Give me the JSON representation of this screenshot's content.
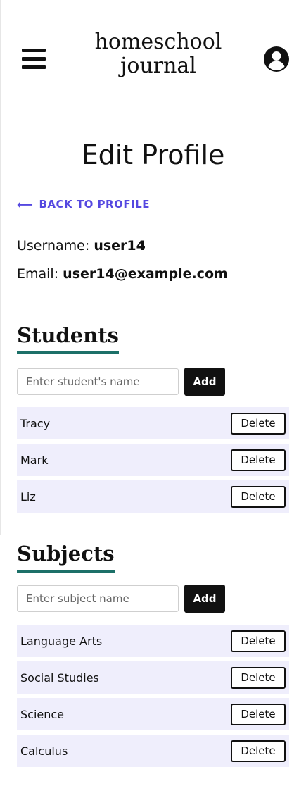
{
  "header": {
    "logo_line1": "homeschool",
    "logo_line2": "journal"
  },
  "page": {
    "title": "Edit Profile",
    "back_label": "BACK TO PROFILE",
    "back_arrow": "⟵"
  },
  "profile": {
    "username_label": "Username:",
    "username": "user14",
    "email_label": "Email:",
    "email": "user14@example.com"
  },
  "students": {
    "heading": "Students",
    "placeholder": "Enter student's name",
    "add_label": "Add",
    "items": [
      {
        "name": "Tracy",
        "delete_label": "Delete"
      },
      {
        "name": "Mark",
        "delete_label": "Delete"
      },
      {
        "name": "Liz",
        "delete_label": "Delete"
      }
    ]
  },
  "subjects": {
    "heading": "Subjects",
    "placeholder": "Enter subject name",
    "add_label": "Add",
    "items": [
      {
        "name": "Language Arts",
        "delete_label": "Delete"
      },
      {
        "name": "Social Studies",
        "delete_label": "Delete"
      },
      {
        "name": "Science",
        "delete_label": "Delete"
      },
      {
        "name": "Calculus",
        "delete_label": "Delete"
      }
    ]
  },
  "colors": {
    "accent_link": "#5548e0",
    "heading_underline": "#1c7068",
    "row_background": "#efeefc"
  },
  "icons": {
    "menu": "hamburger-menu-icon",
    "account": "user-account-icon",
    "back": "arrow-left-icon"
  }
}
